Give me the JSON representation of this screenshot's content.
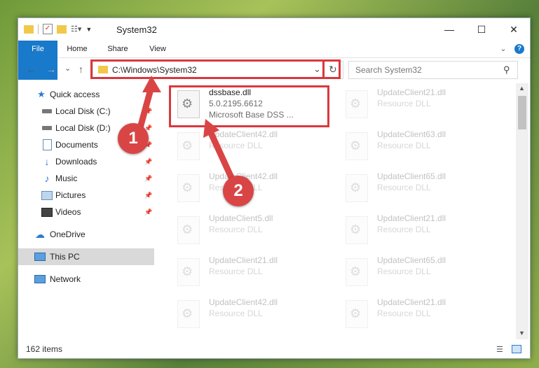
{
  "window": {
    "title": "System32",
    "minimize": "—",
    "maximize": "☐",
    "close": "✕"
  },
  "ribbon": {
    "tabs": [
      "File",
      "Home",
      "Share",
      "View"
    ],
    "collapse": "⌄",
    "help": "?"
  },
  "nav": {
    "back": "←",
    "forward": "→",
    "recent": "⌄",
    "up": "↑"
  },
  "address": {
    "path": "C:\\Windows\\System32",
    "dropdown": "⌄",
    "refresh": "↻"
  },
  "search": {
    "placeholder": "Search System32"
  },
  "sidebar": {
    "quick_access": "Quick access",
    "items": [
      {
        "label": "Local Disk (C:)",
        "icon": "drive-icon"
      },
      {
        "label": "Local Disk (D:)",
        "icon": "drive-icon"
      },
      {
        "label": "Documents",
        "icon": "documents-icon"
      },
      {
        "label": "Downloads",
        "icon": "downloads-icon"
      },
      {
        "label": "Music",
        "icon": "music-icon"
      },
      {
        "label": "Pictures",
        "icon": "pictures-icon"
      },
      {
        "label": "Videos",
        "icon": "videos-icon"
      }
    ],
    "onedrive": "OneDrive",
    "this_pc": "This PC",
    "network": "Network"
  },
  "files": [
    {
      "name": "dssbase.dll",
      "line2": "5.0.2195.6612",
      "line3": "Microsoft Base DSS ...",
      "highlighted": true
    },
    {
      "name": "UpdateClient21.dll",
      "line2": "Resource DLL"
    },
    {
      "name": "UpdateClient42.dll",
      "line2": "Resource DLL"
    },
    {
      "name": "UpdateClient63.dll",
      "line2": "Resource DLL"
    },
    {
      "name": "UpdateClient42.dll",
      "line2": "Resource DLL"
    },
    {
      "name": "UpdateClient65.dll",
      "line2": "Resource DLL"
    },
    {
      "name": "UpdateClient5.dll",
      "line2": "Resource DLL"
    },
    {
      "name": "UpdateClient21.dll",
      "line2": "Resource DLL"
    },
    {
      "name": "UpdateClient21.dll",
      "line2": "Resource DLL"
    },
    {
      "name": "UpdateClient65.dll",
      "line2": "Resource DLL"
    },
    {
      "name": "UpdateClient42.dll",
      "line2": "Resource DLL"
    },
    {
      "name": "UpdateClient21.dll",
      "line2": "Resource DLL"
    }
  ],
  "status": {
    "items": "162 items"
  },
  "annotations": {
    "badge1": "1",
    "badge2": "2",
    "color": "#d94545"
  },
  "accent": "#1979ca"
}
